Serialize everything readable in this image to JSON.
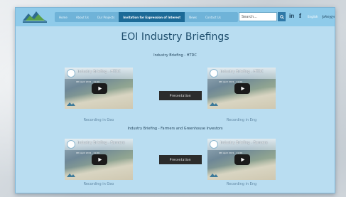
{
  "nav": {
    "items": [
      {
        "label": "Home",
        "active": false
      },
      {
        "label": "About Us",
        "active": false
      },
      {
        "label": "Our Projects",
        "active": false
      },
      {
        "label": "Invitation for Expression of Interest",
        "active": true
      },
      {
        "label": "News",
        "active": false
      },
      {
        "label": "Contact Us",
        "active": false
      }
    ]
  },
  "search": {
    "placeholder": "Search..."
  },
  "social": {
    "linkedin": "in",
    "facebook": "f"
  },
  "lang": {
    "english": "English",
    "georgian": "ქართული"
  },
  "page_title": "EOI Industry Briefings",
  "sections": [
    {
      "title": "Industry Briefing - HTDC",
      "presentation_label": "Presentation",
      "videos": [
        {
          "title": "Industry Briefing - HTDC",
          "date": "9th April 2021 - 11:00",
          "caption": "Recording in Geo"
        },
        {
          "title": "Industry Briefing - HTDC",
          "date": "9th April 2021 - 11:00",
          "caption": "Recording in Eng"
        }
      ]
    },
    {
      "title": "Industry Briefing - Farmers and Greenhouse Investors",
      "presentation_label": "Presentation",
      "videos": [
        {
          "title": "Industry Briefing - Farmers",
          "date": "9th April 2021 - 11:00",
          "caption": "Recording in Geo"
        },
        {
          "title": "Industry Briefing - Farmers",
          "date": "9th April 2021 - 11:00",
          "caption": "Recording in Eng"
        }
      ]
    }
  ],
  "colors": {
    "page_bg": "#b9ddf1",
    "topbar": "#8fcbea",
    "nav_active": "#1c6a97",
    "title": "#1f4e6d",
    "button": "#2c2c2c"
  }
}
